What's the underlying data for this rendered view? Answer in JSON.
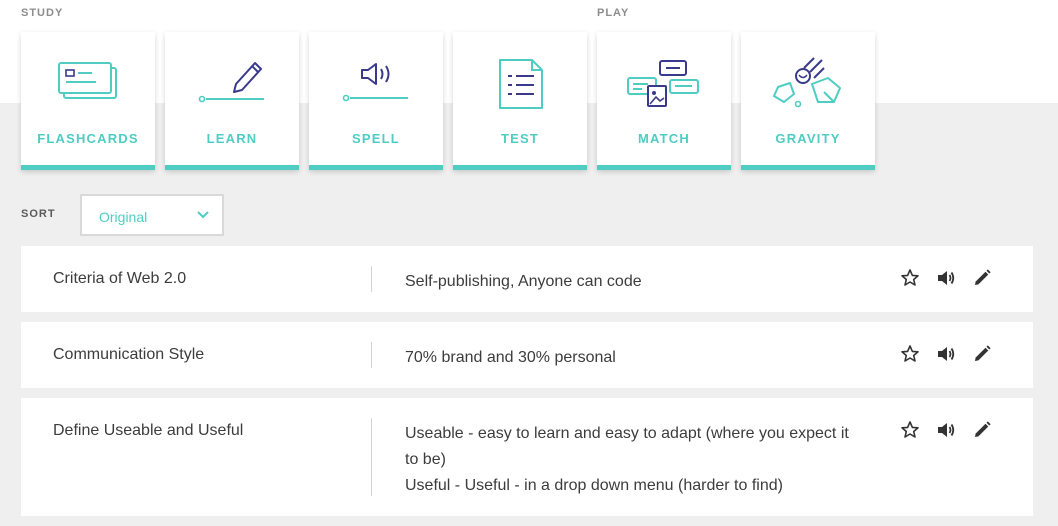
{
  "sections": {
    "study": "STUDY",
    "play": "PLAY"
  },
  "modes": [
    {
      "label": "FLASHCARDS",
      "icon": "flashcards-icon"
    },
    {
      "label": "LEARN",
      "icon": "learn-pencil-icon"
    },
    {
      "label": "SPELL",
      "icon": "spell-speaker-icon"
    },
    {
      "label": "TEST",
      "icon": "test-document-icon"
    },
    {
      "label": "MATCH",
      "icon": "match-cards-icon"
    },
    {
      "label": "GRAVITY",
      "icon": "gravity-asteroid-icon"
    }
  ],
  "sort": {
    "label": "SORT",
    "value": "Original"
  },
  "terms": [
    {
      "term": "Criteria of Web 2.0",
      "definition": [
        "Self-publishing, Anyone can code"
      ]
    },
    {
      "term": "Communication Style",
      "definition": [
        "70% brand and 30% personal"
      ]
    },
    {
      "term": "Define Useable and Useful",
      "definition": [
        "Useable - easy to learn and easy to adapt (where you expect it",
        "to be)",
        "Useful - Useful - in a drop down menu (harder to find)"
      ]
    }
  ],
  "colors": {
    "accent": "#4fcdc3",
    "icon_dark": "#3a3a8c",
    "background": "#efefef"
  }
}
